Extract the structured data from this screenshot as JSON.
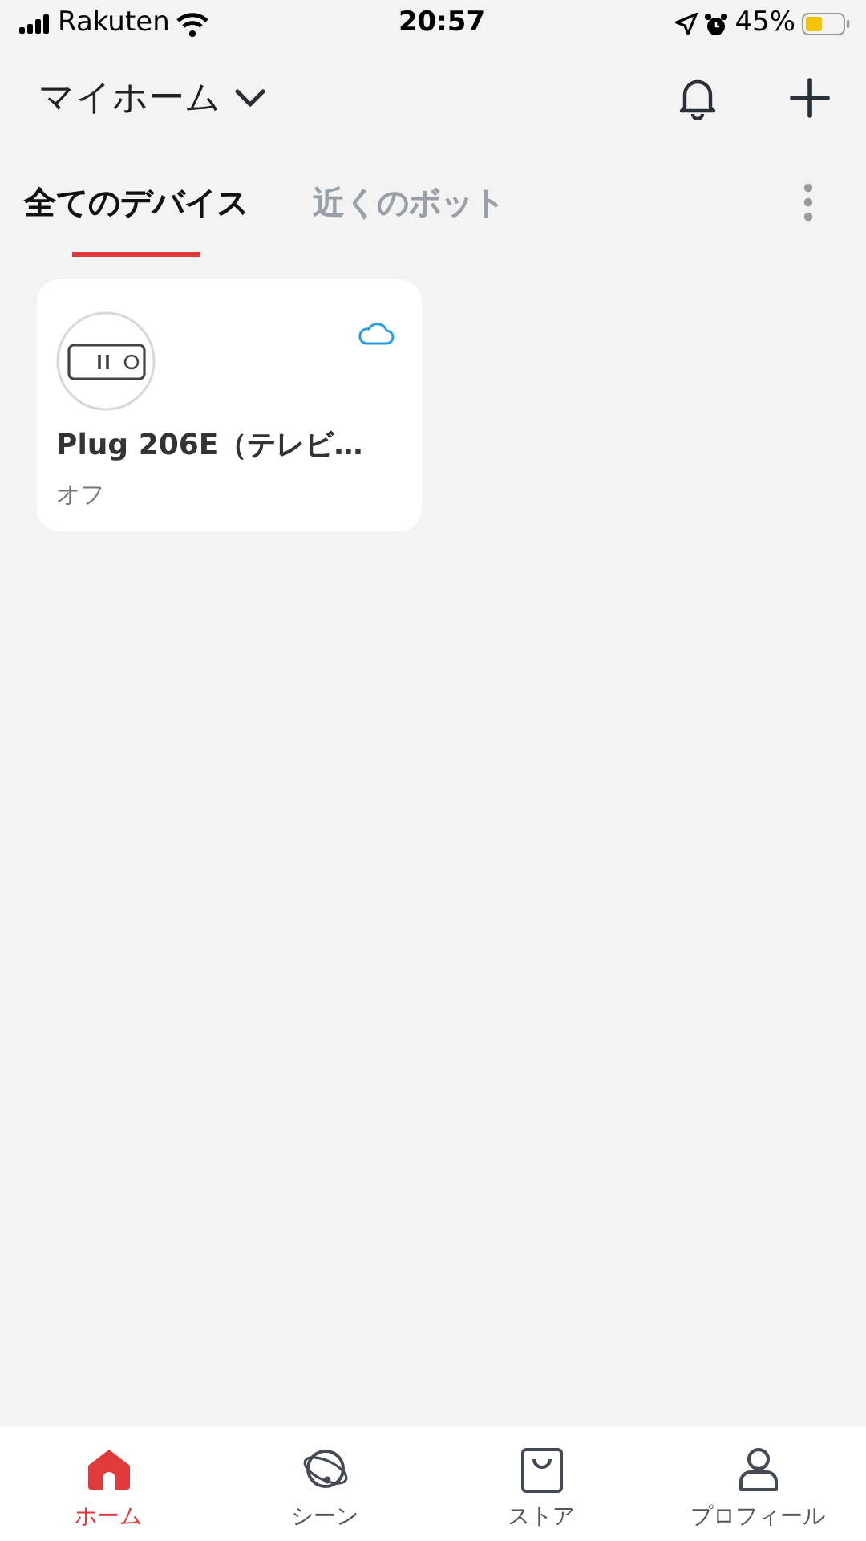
{
  "status_bar": {
    "carrier": "Rakuten",
    "time": "20:57",
    "battery": "45%"
  },
  "header": {
    "home_name": "マイホーム"
  },
  "tabs": [
    {
      "label": "全てのデバイス",
      "selected": true
    },
    {
      "label": "近くのボット",
      "selected": false
    }
  ],
  "devices": [
    {
      "name": "Plug 206E（テレビ…",
      "status": "オフ",
      "kind": "plug"
    }
  ],
  "bottom_nav": [
    {
      "label": "ホーム",
      "kind": "home",
      "selected": true
    },
    {
      "label": "シーン",
      "kind": "scene",
      "selected": false
    },
    {
      "label": "ストア",
      "kind": "store",
      "selected": false
    },
    {
      "label": "プロフィール",
      "kind": "profile",
      "selected": false
    }
  ]
}
